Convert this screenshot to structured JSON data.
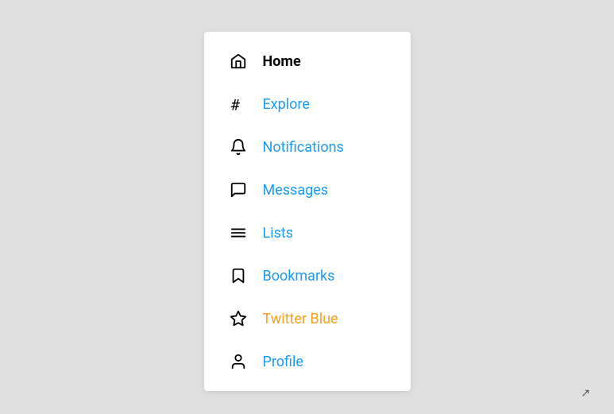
{
  "nav": {
    "items": [
      {
        "id": "home",
        "label": "Home",
        "labelClass": "active",
        "icon": "home-icon"
      },
      {
        "id": "explore",
        "label": "Explore",
        "labelClass": "blue",
        "icon": "explore-icon"
      },
      {
        "id": "notifications",
        "label": "Notifications",
        "labelClass": "blue",
        "icon": "notifications-icon"
      },
      {
        "id": "messages",
        "label": "Messages",
        "labelClass": "blue",
        "icon": "messages-icon"
      },
      {
        "id": "lists",
        "label": "Lists",
        "labelClass": "blue",
        "icon": "lists-icon"
      },
      {
        "id": "bookmarks",
        "label": "Bookmarks",
        "labelClass": "blue",
        "icon": "bookmarks-icon"
      },
      {
        "id": "twitter-blue",
        "label": "Twitter Blue",
        "labelClass": "orange",
        "icon": "twitter-blue-icon"
      },
      {
        "id": "profile",
        "label": "Profile",
        "labelClass": "blue",
        "icon": "profile-icon"
      }
    ]
  }
}
